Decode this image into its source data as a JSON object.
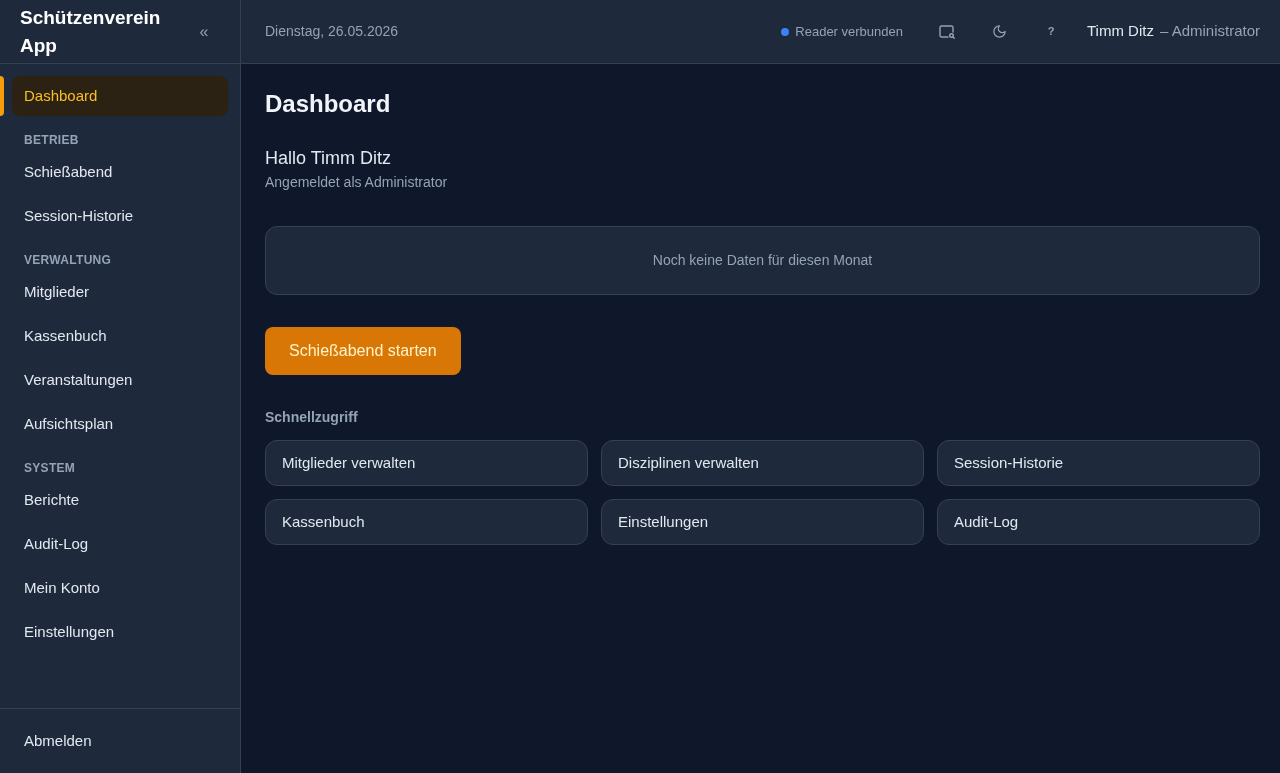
{
  "sidebar": {
    "app_title": "Schützenverein App",
    "collapse_label": "«",
    "sections": [
      {
        "items": [
          {
            "label": "Dashboard",
            "selected": true
          }
        ]
      },
      {
        "heading": "BETRIEB",
        "items": [
          {
            "label": "Schießabend",
            "selected": false
          },
          {
            "label": "Session-Historie",
            "selected": false
          }
        ]
      },
      {
        "heading": "VERWALTUNG",
        "items": [
          {
            "label": "Mitglieder",
            "selected": false
          },
          {
            "label": "Kassenbuch",
            "selected": false
          },
          {
            "label": "Veranstaltungen",
            "selected": false
          },
          {
            "label": "Aufsichtsplan",
            "selected": false
          }
        ]
      },
      {
        "heading": "SYSTEM",
        "items": [
          {
            "label": "Berichte",
            "selected": false
          },
          {
            "label": "Audit-Log",
            "selected": false
          },
          {
            "label": "Mein Konto",
            "selected": false
          },
          {
            "label": "Einstellungen",
            "selected": false
          }
        ]
      }
    ],
    "logout_label": "Abmelden"
  },
  "header": {
    "date": "Dienstag, 26.05.2026",
    "reader": {
      "label": "Reader verbunden",
      "connected": true
    },
    "help_label": "?",
    "user": {
      "name": "Timm Ditz",
      "role_label": "– Administrator"
    }
  },
  "main": {
    "title": "Dashboard",
    "greeting": "Hallo Timm Ditz",
    "subtitle": "Angemeldet als Administrator",
    "empty_message": "Noch keine Daten für diesen Monat",
    "primary_button": "Schießabend starten",
    "quick_access": {
      "heading": "Schnellzugriff",
      "items": [
        "Mitglieder verwalten",
        "Disziplinen verwalten",
        "Session-Historie",
        "Kassenbuch",
        "Einstellungen",
        "Audit-Log"
      ]
    }
  }
}
